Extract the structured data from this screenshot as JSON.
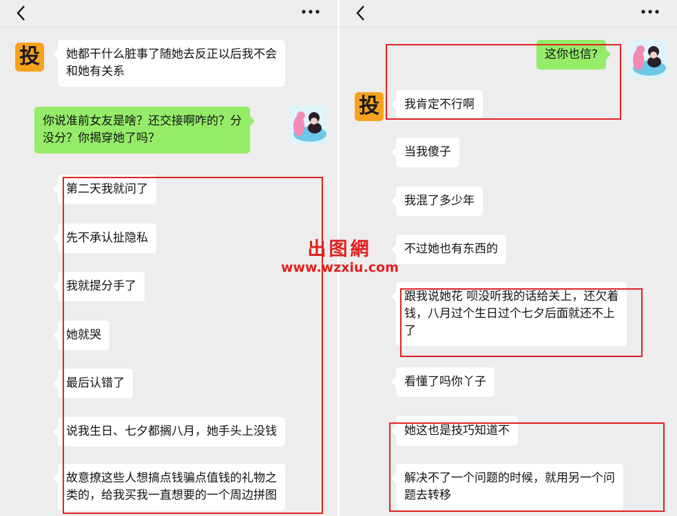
{
  "left": {
    "messages": [
      {
        "lines": [
          "她都干什么脏事了随她去反正以后我不会",
          "和她有关系"
        ]
      },
      {
        "lines": [
          "你说准前女友是啥？还交接啊咋的？分",
          "没分？你揭穿她了吗？"
        ]
      },
      {
        "lines": [
          "第二天我就问了"
        ]
      },
      {
        "lines": [
          "先不承认扯隐私"
        ]
      },
      {
        "lines": [
          "我就提分手了"
        ]
      },
      {
        "lines": [
          "她就哭"
        ]
      },
      {
        "lines": [
          "最后认错了"
        ]
      },
      {
        "lines": [
          "说我生日、七夕都搁八月，她手头上没钱"
        ]
      },
      {
        "lines": [
          "故意撩这些人想搞点钱骗点值钱的礼物之",
          "类的，给我买我一直想要的一个周边拼图"
        ]
      }
    ]
  },
  "right": {
    "messages": [
      {
        "lines": [
          "这你也信?"
        ]
      },
      {
        "lines": [
          "我肯定不行啊"
        ]
      },
      {
        "lines": [
          "当我傻子"
        ]
      },
      {
        "lines": [
          "我混了多少年"
        ]
      },
      {
        "lines": [
          "不过她也有东西的"
        ]
      },
      {
        "lines": [
          "跟我说她花 呗没听我的话给关上，还欠着",
          "钱，八月过个生日过个七夕后面就还不上",
          "了"
        ]
      },
      {
        "lines": [
          "看懂了吗你丫子"
        ]
      },
      {
        "lines": [
          "她这也是技巧知道不"
        ]
      },
      {
        "lines": [
          "解决不了一个问题的时候，就用另一个问",
          "题去转移"
        ]
      }
    ]
  },
  "avatar_text": "投",
  "watermark": {
    "cn": "出图網",
    "url": "www.wzxiu.com"
  },
  "icons": {
    "back": "chevron-left-icon",
    "more": "more-dots-icon"
  },
  "colors": {
    "background": "#ededed",
    "bubble_white": "#ffffff",
    "bubble_green": "#95ec69",
    "avatar_orange": "#f6a21d",
    "highlight_red": "#e02020"
  }
}
